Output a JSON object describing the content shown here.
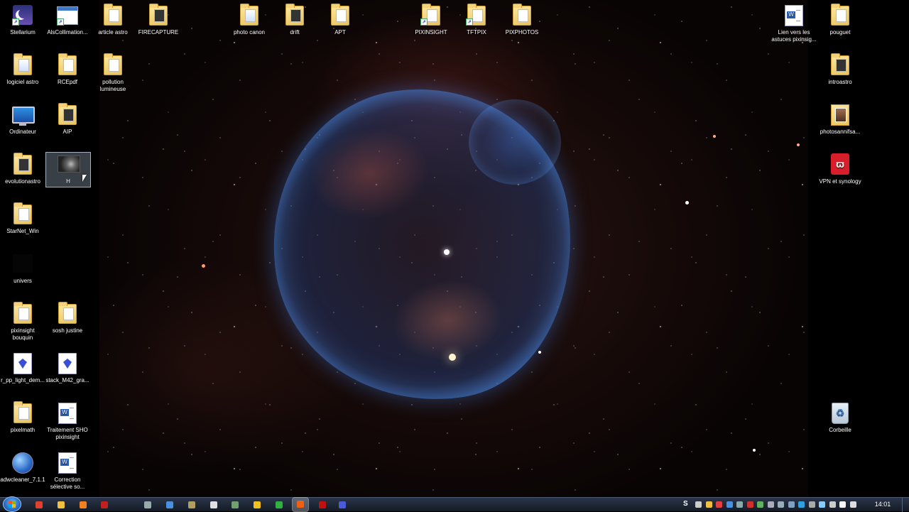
{
  "desktop": {
    "left_icons": [
      {
        "label": "Stellarium",
        "icon": "stellarium-icon"
      },
      {
        "label": "AlsCollimation...",
        "icon": "alscollimation-icon"
      },
      {
        "label": "article astro",
        "icon": "folder-icon"
      },
      {
        "label": "FIRECAPTURE",
        "icon": "folder-icon"
      },
      {
        "label": "logiciel astro",
        "icon": "folder-icon"
      },
      {
        "label": "RCEpdf",
        "icon": "folder-icon"
      },
      {
        "label": "pollution lumineuse",
        "icon": "folder-icon"
      },
      {
        "label": "Ordinateur",
        "icon": "computer-icon"
      },
      {
        "label": "AIP",
        "icon": "folder-icon"
      },
      {
        "label": "evolutionastro",
        "icon": "folder-icon"
      },
      {
        "label": "H",
        "icon": "image-file-icon"
      },
      {
        "label": "StarNet_Win",
        "icon": "folder-icon"
      },
      {
        "label": "univers",
        "icon": "black-file-icon"
      },
      {
        "label": "pixinsight bouquin",
        "icon": "folder-icon"
      },
      {
        "label": "sosh justine",
        "icon": "folder-icon"
      },
      {
        "label": "r_pp_light_dem...",
        "icon": "pixinsight-file-icon"
      },
      {
        "label": "stack_M42_gra...",
        "icon": "pixinsight-file-icon"
      },
      {
        "label": "pixelmath",
        "icon": "folder-icon"
      },
      {
        "label": "Traitement SHO pixinsight",
        "icon": "word-document-icon"
      },
      {
        "label": "adwcleaner_7.1.1",
        "icon": "adwcleaner-icon"
      },
      {
        "label": "Correction sélective so...",
        "icon": "word-document-icon"
      }
    ],
    "top_icons": [
      {
        "label": "photo canon",
        "icon": "folder-icon"
      },
      {
        "label": "drift",
        "icon": "folder-icon"
      },
      {
        "label": "APT",
        "icon": "folder-icon"
      },
      {
        "label": "PIXINSIGHT",
        "icon": "folder-icon"
      },
      {
        "label": "TFTPIX",
        "icon": "folder-icon"
      },
      {
        "label": "PIXPHOTOS",
        "icon": "folder-icon"
      }
    ],
    "right_icons": [
      {
        "label": "Lien vers les astuces pixinsig...",
        "icon": "word-document-icon"
      },
      {
        "label": "pouguet",
        "icon": "folder-icon"
      },
      {
        "label": "introastro",
        "icon": "folder-icon"
      },
      {
        "label": "photosannifsa...",
        "icon": "photo-folder-icon"
      },
      {
        "label": "VPN et synology",
        "icon": "vpn-icon"
      },
      {
        "label": "Corbeille",
        "icon": "recycle-bin-icon"
      }
    ],
    "selected_icon": "H"
  },
  "taskbar": {
    "start_label": "",
    "pinned": [
      {
        "name": "media-player-icon",
        "color": "#e04030"
      },
      {
        "name": "explorer-icon",
        "color": "#f0c040"
      },
      {
        "name": "vlc-icon",
        "color": "#f08020"
      },
      {
        "name": "filezilla-icon",
        "color": "#c02020"
      },
      {
        "name": "audio-icon",
        "color": "#9aa"
      },
      {
        "name": "monitor-app-icon",
        "color": "#4a90e0"
      },
      {
        "name": "tools-icon",
        "color": "#b0a060"
      },
      {
        "name": "chrome-icon",
        "color": "#e0e0e0"
      },
      {
        "name": "network-icon",
        "color": "#70a070"
      },
      {
        "name": "norton-icon",
        "color": "#f0c020"
      },
      {
        "name": "green-app-icon",
        "color": "#30b040"
      },
      {
        "name": "firefox-icon",
        "color": "#f06010"
      },
      {
        "name": "acrobat-icon",
        "color": "#c01010"
      },
      {
        "name": "pixinsight-icon",
        "color": "#4a5ad8"
      }
    ],
    "active_index": 11,
    "tray": {
      "s_label": "S",
      "clock": "14:01"
    }
  }
}
